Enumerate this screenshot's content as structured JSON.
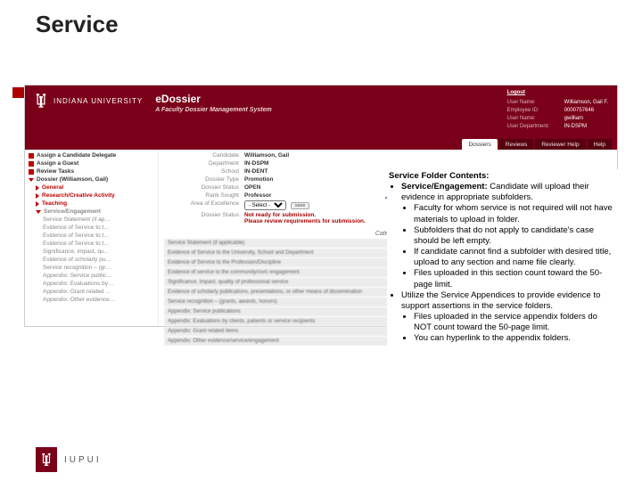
{
  "page": {
    "title": "Service"
  },
  "banner": {
    "university": "INDIANA UNIVERSITY",
    "product": "eDossier",
    "subtitle": "A Faculty Dossier Management System",
    "logout": "Logout",
    "info": [
      {
        "label": "User Name:",
        "value": "Williamson, Gail F."
      },
      {
        "label": "Employee ID:",
        "value": "0000757646"
      },
      {
        "label": "User Name:",
        "value": "gwilliam"
      },
      {
        "label": "User Department:",
        "value": "IN-DSPM"
      }
    ],
    "tabs": [
      "Dossiers",
      "Reviews",
      "Reviewer Help",
      "Help"
    ]
  },
  "sidebar": {
    "top": [
      "Assign a Candidate Delegate",
      "Assign a Guest",
      "Review Tasks"
    ],
    "dossier": "Dossier (Williamson, Gail)",
    "folders": [
      "General",
      "Research/Creative Activity",
      "Teaching"
    ],
    "active": "Service/Engagement",
    "subitems": [
      "Service Statement (if ap…",
      "Evidence of Service to t…",
      "Evidence of Service to t…",
      "Evidence of Service to t…",
      "Significance, impact, qu…",
      "Evidence of scholarly pu…",
      "Service recognition – (gr…",
      "Appendix: Service public…",
      "Appendix: Evaluations by…",
      "Appendix: Grant related …",
      "Appendix: Other evidence…"
    ]
  },
  "main": {
    "rows": [
      {
        "label": "Candidate",
        "value": "Williamson, Gail"
      },
      {
        "label": "Department",
        "value": "IN-DSPM"
      },
      {
        "label": "School",
        "value": "IN-DENT"
      },
      {
        "label": "Dossier Type",
        "value": "Promotion"
      },
      {
        "label": "Dossier Status",
        "value": "OPEN"
      },
      {
        "label": "Rank Sought",
        "value": "Professor"
      }
    ],
    "aoe_label": "Area of Excellence",
    "aoe_select": "- Select -",
    "save": "save",
    "status_label": "Dossier Status",
    "status_msg1": "Not ready for submission.",
    "status_msg2": "Please review requirements for submission.",
    "category_header": "Category",
    "categories": [
      "Service Statement (if applicable)",
      "Evidence of Service to the University, School and Department",
      "Evidence of Service to the Profession/Discipline",
      "Evidence of service to the community/civic engagement",
      "Significance, impact, quality of professional service",
      "Evidence of scholarly publications, presentations, or other means of dissemination",
      "Service recognition – (grants, awards, honors)",
      "Appendix: Service publications",
      "Appendix: Evaluations by clients, patients or service recipients",
      "Appendix: Grant related items",
      "Appendix: Other evidence/service/engagement"
    ]
  },
  "overlay": {
    "header": "Service Folder Contents:",
    "b1_label": "Service/Engagement:",
    "b1_text": " Candidate will upload their evidence in appropriate subfolders.",
    "sub1": [
      "Faculty for whom service is not required will not have materials to upload in folder.",
      "Subfolders that do not apply to candidate's case should be left empty.",
      "If candidate cannot find a subfolder with desired title, upload to any section and name file clearly.",
      "Files uploaded in this section count toward the 50-page limit."
    ],
    "b2": "Utilize the Service Appendices to provide evidence to support assertions in the service folders.",
    "sub2": [
      "Files uploaded in the service appendix folders do NOT count toward the 50-page limit.",
      "You can hyperlink to the appendix folders."
    ]
  },
  "footer": {
    "text": "IUPUI"
  }
}
